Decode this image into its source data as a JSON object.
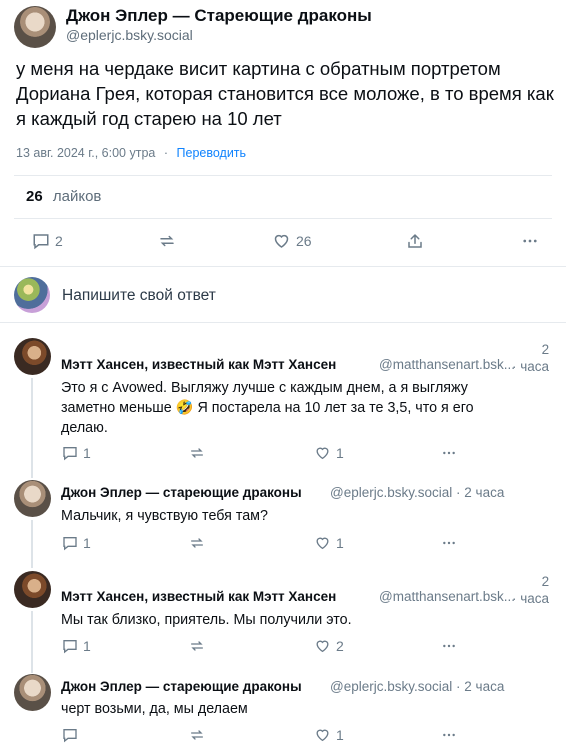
{
  "post": {
    "author": "Джон Эплер — Стареющие драконы",
    "handle": "@eplerjc.bsky.social",
    "text": "у меня на чердаке висит картина с обратным портретом Дориана Грея, которая становится все моложе, в то время как я каждый год старею на 10 лет",
    "date": "13 авг. 2024 г., 6:00 утра",
    "sep": "·",
    "translate": "Переводить",
    "likes_count": "26",
    "likes_label": "лайков",
    "actions": {
      "replies": "2",
      "likes": "26"
    }
  },
  "composer": {
    "placeholder": "Напишите свой ответ"
  },
  "replies": [
    {
      "author": "Мэтт Хансен, известный как Мэтт Хансен",
      "handle": "@matthansenart.bsk...",
      "sep": "·",
      "time_num": "2",
      "time_unit": "часа",
      "text": "Это я с Avowed. Выгляжу лучше с каждым днем, а я выгляжу заметно меньше 🤣 Я постарела на 10 лет за те 3,5, что я его делаю.",
      "replies": "1",
      "likes": "1"
    },
    {
      "author": "Джон Эплер — стареющие драконы",
      "handle": "@eplerjc.bsky.social",
      "sep": "·",
      "time": "2 часа",
      "text": "Мальчик, я чувствую тебя там?",
      "replies": "1",
      "likes": "1"
    },
    {
      "author": "Мэтт Хансен, известный как Мэтт Хансен",
      "handle": "@matthansenart.bsk...",
      "sep": "·",
      "time_num": "2",
      "time_unit": "часа",
      "text": "Мы так близко, приятель. Мы получили это.",
      "replies": "1",
      "likes": "2"
    },
    {
      "author": "Джон Эплер — стареющие драконы",
      "handle": "@eplerjc.bsky.social",
      "sep": "·",
      "time": "2 часа",
      "text": "черт возьми, да, мы делаем",
      "replies": "",
      "likes": "1"
    }
  ],
  "icons": {
    "reply": "speech-bubble-icon",
    "repost": "repost-arrows-icon",
    "like": "heart-icon",
    "share": "share-upload-icon",
    "more": "ellipsis-icon"
  },
  "colors": {
    "link": "#1083fe",
    "muted": "#6b7b89",
    "divider": "#e6eaee"
  }
}
